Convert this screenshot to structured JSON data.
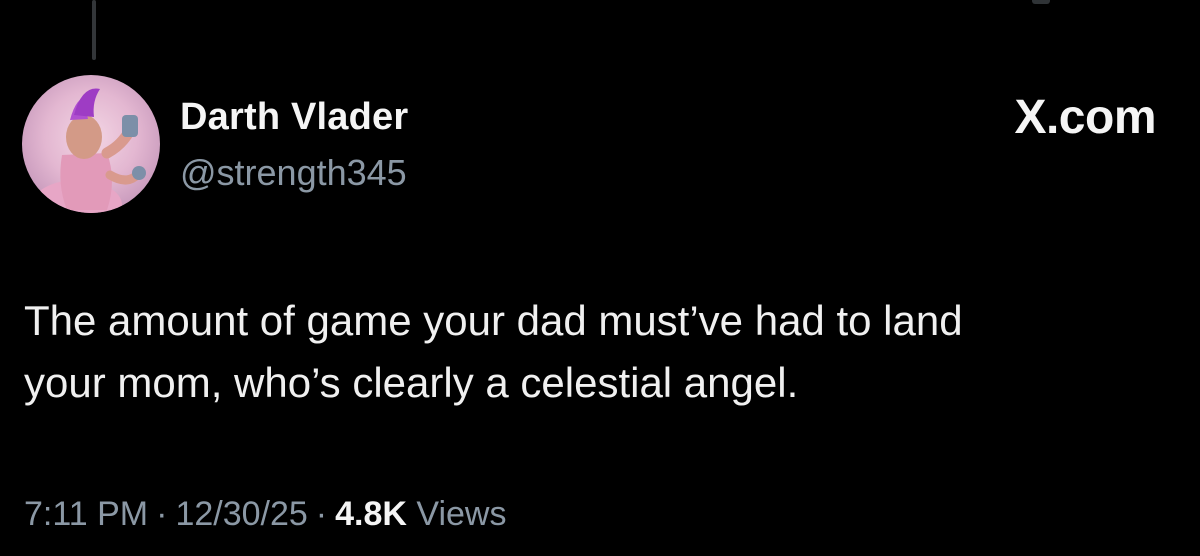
{
  "author": {
    "display_name": "Darth Vlader",
    "handle": "@strength345",
    "avatar_icon": "profile-photo"
  },
  "brand": {
    "label": "X.com"
  },
  "tweet": {
    "lines": [
      "The amount of game your dad must’ve had to land",
      "your mom, who’s clearly a celestial angel."
    ]
  },
  "meta": {
    "time": "7:11 PM",
    "separator": "·",
    "date": "12/30/25",
    "views_count": "4.8K",
    "views_label": "Views"
  },
  "colors": {
    "background": "#000000",
    "primary_text": "#e7e9ea",
    "secondary_text": "#8b98a5"
  }
}
